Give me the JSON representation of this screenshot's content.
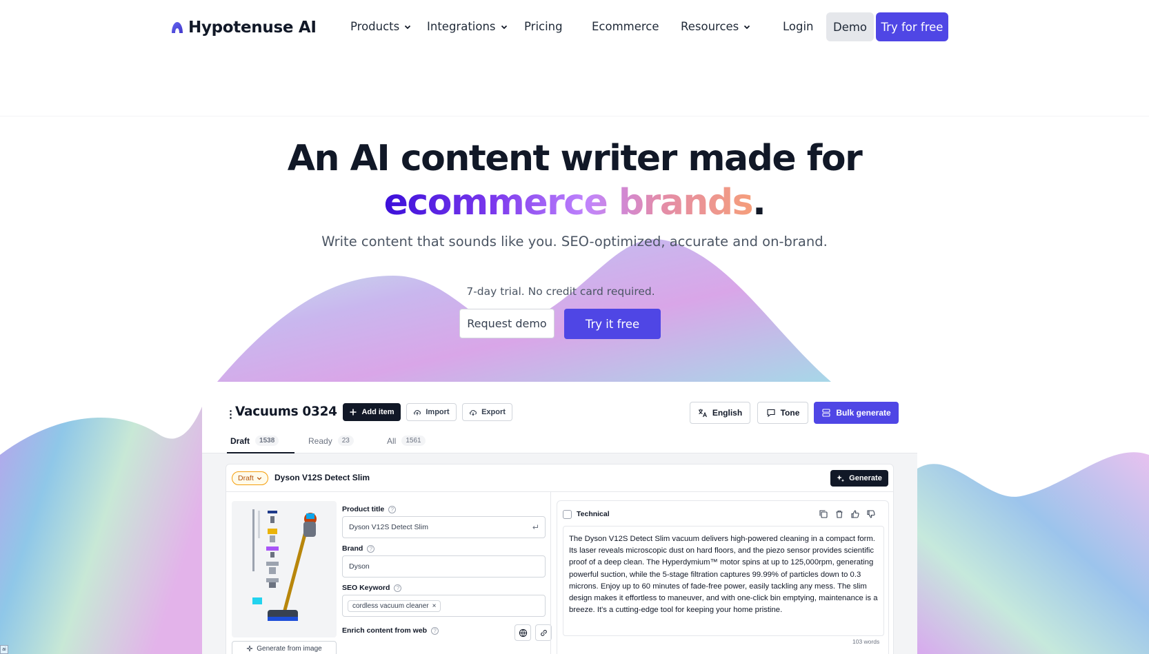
{
  "nav": {
    "brand": "Hypotenuse AI",
    "items": [
      {
        "label": "Products",
        "has_dropdown": true
      },
      {
        "label": "Integrations",
        "has_dropdown": true
      },
      {
        "label": "Pricing",
        "has_dropdown": false
      },
      {
        "label": "Ecommerce",
        "has_dropdown": false
      },
      {
        "label": "Resources",
        "has_dropdown": true
      }
    ],
    "login": "Login",
    "demo": "Demo",
    "try_free": "Try for free"
  },
  "hero": {
    "title_line1": "An AI content writer made for",
    "title_highlight": "ecommerce brands",
    "title_period": ".",
    "subtitle": "Write content that sounds like you. SEO-optimized, accurate and on-brand.",
    "trial_note": "7-day trial. No credit card required.",
    "request_demo": "Request demo",
    "try_it_free": "Try it free"
  },
  "app": {
    "title": "Vacuums 0324",
    "buttons": {
      "add_item": "Add item",
      "import": "Import",
      "export": "Export",
      "language": "English",
      "tone": "Tone",
      "bulk_generate": "Bulk generate"
    },
    "tabs": [
      {
        "label": "Draft",
        "count": "1538"
      },
      {
        "label": "Ready",
        "count": "23"
      },
      {
        "label": "All",
        "count": "1561"
      }
    ],
    "card": {
      "status": "Draft",
      "product_name": "Dyson V12S Detect Slim",
      "generate": "Generate",
      "generate_from_image": "Generate from image",
      "fields": {
        "product_title_label": "Product title",
        "product_title_value": "Dyson V12S Detect Slim",
        "brand_label": "Brand",
        "brand_value": "Dyson",
        "seo_label": "SEO Keyword",
        "seo_chip": "cordless vacuum cleaner",
        "enrich_label": "Enrich content from web"
      },
      "panel": {
        "title": "Technical",
        "text": "The Dyson V12S Detect Slim vacuum delivers high-powered cleaning in a compact form. Its laser reveals microscopic dust on hard floors, and the piezo sensor provides scientific proof of a deep clean. The Hyperdymium™ motor spins at up to 125,000rpm, generating powerful suction, while the 5-stage filtration captures 99.99% of particles down to 0.3 microns. Enjoy up to 60 minutes of fade-free power, easily tackling any mess. The slim design makes it effortless to maneuver, and with one-click bin emptying, maintenance is a breeze. It's a cutting-edge tool for keeping your home pristine.",
        "word_count": "103 words"
      }
    }
  },
  "corner_badge": "ai",
  "colors": {
    "accent": "#4f46e5",
    "dark": "#111827"
  }
}
